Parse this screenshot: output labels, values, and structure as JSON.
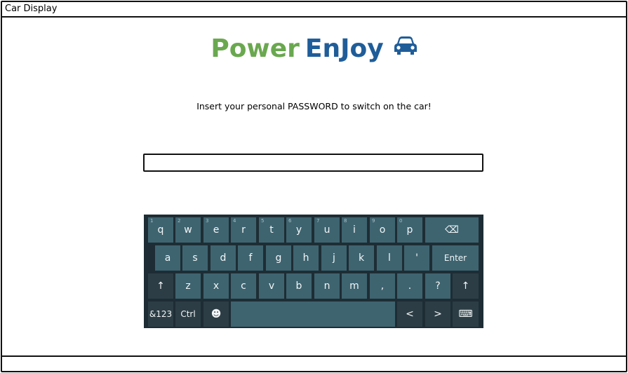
{
  "window": {
    "title": "Car Display"
  },
  "logo": {
    "word1": "Power",
    "word2": "EnJoy",
    "icon": "car-icon",
    "color1": "#6aa84f",
    "color2": "#1f5d99"
  },
  "prompt": "Insert your personal PASSWORD to switch on the car!",
  "password": {
    "value": "",
    "placeholder": ""
  },
  "keyboard": {
    "row1": [
      {
        "label": "q",
        "num": "1"
      },
      {
        "label": "w",
        "num": "2"
      },
      {
        "label": "e",
        "num": "3"
      },
      {
        "label": "r",
        "num": "4"
      },
      {
        "label": "t",
        "num": "5"
      },
      {
        "label": "y",
        "num": "6"
      },
      {
        "label": "u",
        "num": "7"
      },
      {
        "label": "i",
        "num": "8"
      },
      {
        "label": "o",
        "num": "9"
      },
      {
        "label": "p",
        "num": "0"
      },
      {
        "label": "⌫",
        "num": ""
      }
    ],
    "row2": [
      "a",
      "s",
      "d",
      "f",
      "g",
      "h",
      "j",
      "k",
      "l",
      "'",
      "Enter"
    ],
    "row3": [
      "↑",
      "z",
      "x",
      "c",
      "v",
      "b",
      "n",
      "m",
      ",",
      ".",
      "?",
      "↑"
    ],
    "row4": [
      "&123",
      "Ctrl",
      "☻",
      "",
      "<",
      ">",
      "⌨"
    ]
  },
  "colors": {
    "key": "#3e6470",
    "key_dark": "#2c3d45",
    "keyboard_bg": "#1e2d35"
  }
}
